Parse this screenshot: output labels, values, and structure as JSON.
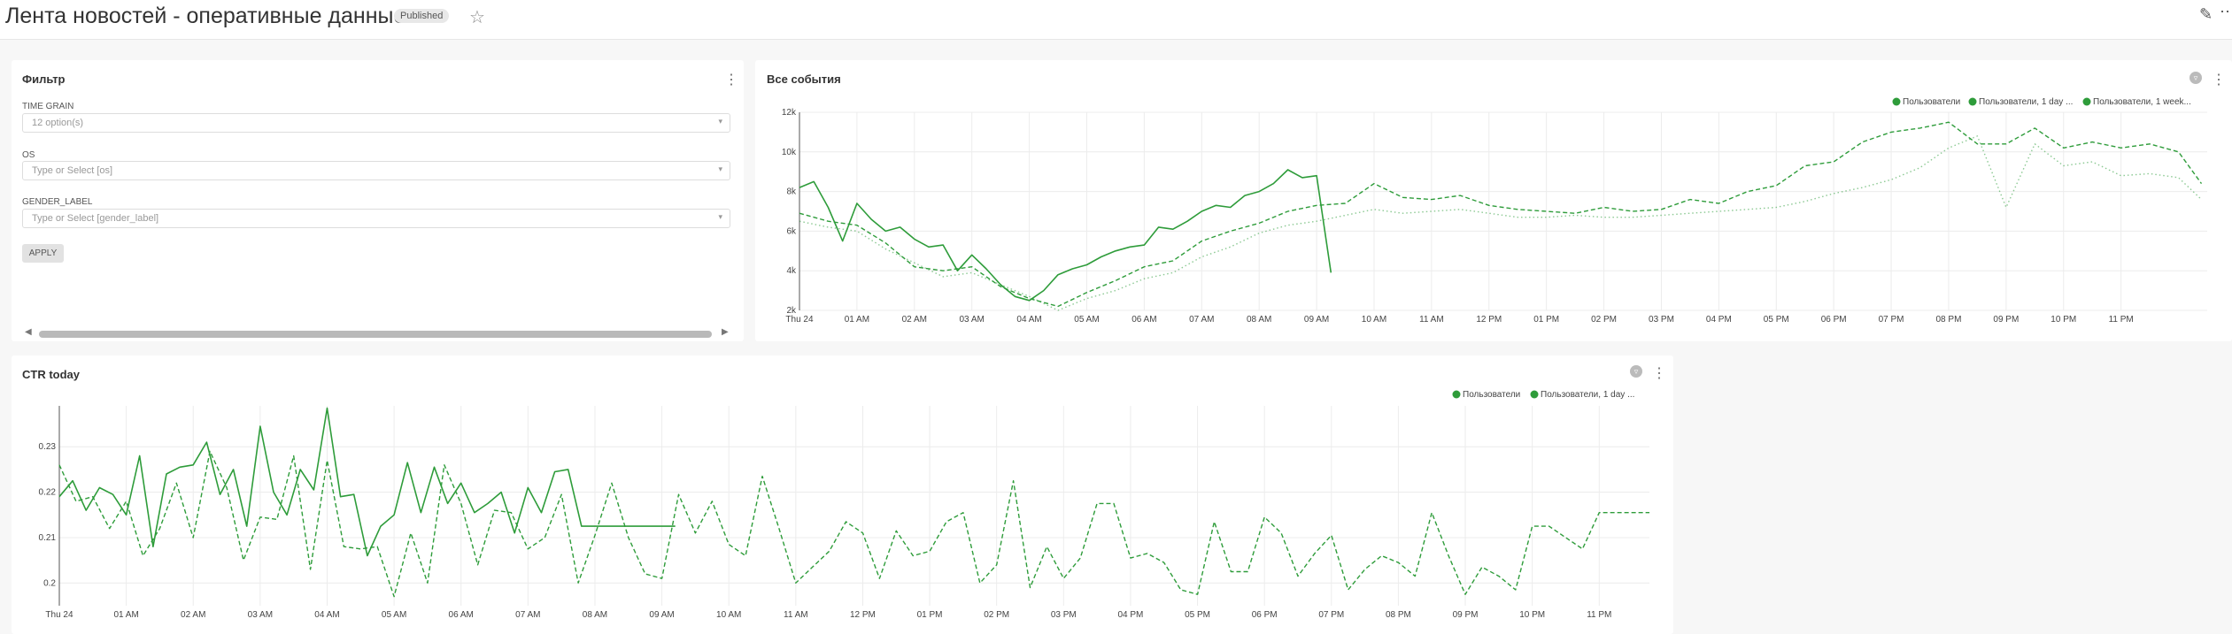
{
  "header": {
    "title": "Лента новостей - оперативные данные",
    "badge": "Published",
    "star_icon": "star-icon",
    "edit_icon": "edit-icon",
    "more_icon": "more-icon"
  },
  "filter_panel": {
    "title": "Фильтр",
    "fields": [
      {
        "label": "TIME GRAIN",
        "value": "12 option(s)"
      },
      {
        "label": "OS",
        "placeholder": "Type or Select [os]"
      },
      {
        "label": "GENDER_LABEL",
        "placeholder": "Type or Select [gender_label]"
      }
    ],
    "apply_label": "APPLY"
  },
  "colors": {
    "series": "#2e9c3a",
    "grid": "#ececec"
  },
  "chart_data": [
    {
      "type": "line",
      "title": "Все события",
      "legend_position": "top-right",
      "legend": [
        "Пользователи",
        "Пользователи, 1 day ...",
        "Пользователи, 1 week..."
      ],
      "x_tick_labels": [
        "Thu 24",
        "01 AM",
        "02 AM",
        "03 AM",
        "04 AM",
        "05 AM",
        "06 AM",
        "07 AM",
        "08 AM",
        "09 AM",
        "10 AM",
        "11 AM",
        "12 PM",
        "01 PM",
        "02 PM",
        "03 PM",
        "04 PM",
        "05 PM",
        "06 PM",
        "07 PM",
        "08 PM",
        "09 PM",
        "10 PM",
        "11 PM"
      ],
      "x_unit_hours": true,
      "xlim": [
        0,
        24.5
      ],
      "y_tick_labels": [
        "2k",
        "4k",
        "6k",
        "8k",
        "10k",
        "12k"
      ],
      "ylim": [
        2000,
        12000
      ],
      "grid": true,
      "series": [
        {
          "style": "solid",
          "x": [
            0,
            0.25,
            0.5,
            0.75,
            1,
            1.25,
            1.5,
            1.75,
            2,
            2.25,
            2.5,
            2.75,
            3,
            3.25,
            3.5,
            3.75,
            4,
            4.25,
            4.5,
            4.75,
            5,
            5.25,
            5.5,
            5.75,
            6,
            6.25,
            6.5,
            6.75,
            7,
            7.25,
            7.5,
            7.75,
            8,
            8.25,
            8.5,
            8.75,
            9,
            9.25
          ],
          "y": [
            8200,
            8500,
            7200,
            5500,
            7400,
            6600,
            6000,
            6200,
            5600,
            5200,
            5300,
            4000,
            4800,
            4100,
            3300,
            2700,
            2500,
            3000,
            3800,
            4100,
            4300,
            4700,
            5000,
            5200,
            5300,
            6200,
            6100,
            6500,
            7000,
            7300,
            7200,
            7800,
            8000,
            8400,
            9100,
            8700,
            8800,
            3900
          ]
        },
        {
          "style": "dashed",
          "x": [
            0,
            0.5,
            1,
            1.5,
            2,
            2.5,
            3,
            3.5,
            4,
            4.5,
            5,
            5.5,
            6,
            6.5,
            7,
            7.5,
            8,
            8.5,
            9,
            9.5,
            10,
            10.5,
            11,
            11.5,
            12,
            12.5,
            13,
            13.5,
            14,
            14.5,
            15,
            15.5,
            16,
            16.5,
            17,
            17.5,
            18,
            18.5,
            19,
            19.5,
            20,
            20.5,
            21,
            21.5,
            22,
            22.5,
            23,
            23.5,
            24,
            24.4
          ],
          "y": [
            6900,
            6500,
            6300,
            5400,
            4200,
            4000,
            4200,
            3200,
            2600,
            2200,
            2900,
            3500,
            4200,
            4500,
            5500,
            6000,
            6400,
            7000,
            7300,
            7400,
            8400,
            7700,
            7600,
            7800,
            7300,
            7100,
            7000,
            6900,
            7200,
            7000,
            7100,
            7600,
            7400,
            8000,
            8300,
            9300,
            9500,
            10500,
            11000,
            11200,
            11500,
            10400,
            10400,
            11200,
            10200,
            10500,
            10200,
            10400,
            10000,
            8400
          ]
        },
        {
          "style": "dotted",
          "x": [
            0,
            0.5,
            1,
            1.5,
            2,
            2.5,
            3,
            3.5,
            4,
            4.5,
            5,
            5.5,
            6,
            6.5,
            7,
            7.5,
            8,
            8.5,
            9,
            9.5,
            10,
            10.5,
            11,
            11.5,
            12,
            12.5,
            13,
            13.5,
            14,
            14.5,
            15,
            15.5,
            16,
            16.5,
            17,
            17.5,
            18,
            18.5,
            19,
            19.5,
            20,
            20.5,
            21,
            21.5,
            22,
            22.5,
            23,
            23.5,
            24,
            24.4
          ],
          "y": [
            6500,
            6200,
            6000,
            5100,
            4400,
            3700,
            3900,
            3300,
            2700,
            2000,
            2600,
            3000,
            3600,
            3900,
            4700,
            5200,
            5900,
            6300,
            6500,
            6800,
            7100,
            6900,
            7000,
            7100,
            6900,
            6700,
            6700,
            6800,
            6700,
            6700,
            6800,
            6900,
            7000,
            7100,
            7200,
            7500,
            7900,
            8200,
            8600,
            9200,
            10200,
            10800,
            7200,
            10400,
            9300,
            9500,
            8800,
            8900,
            8700,
            7600
          ]
        }
      ]
    },
    {
      "type": "line",
      "title": "CTR today",
      "legend_position": "top-right",
      "legend": [
        "Пользователи",
        "Пользователи, 1 day ..."
      ],
      "x_tick_labels": [
        "Thu 24",
        "01 AM",
        "02 AM",
        "03 AM",
        "04 AM",
        "05 AM",
        "06 AM",
        "07 AM",
        "08 AM",
        "09 AM",
        "10 AM",
        "11 AM",
        "12 PM",
        "01 PM",
        "02 PM",
        "03 PM",
        "04 PM",
        "05 PM",
        "06 PM",
        "07 PM",
        "08 PM",
        "09 PM",
        "10 PM",
        "11 PM"
      ],
      "xlim": [
        0,
        23.75
      ],
      "y_tick_labels": [
        "0.2",
        "0.21",
        "0.22",
        "0.23"
      ],
      "y_tick_values": [
        0.2,
        0.21,
        0.22,
        0.23
      ],
      "ylim": [
        0.195,
        0.239
      ],
      "grid": true,
      "series": [
        {
          "style": "solid",
          "x": [
            0,
            0.2,
            0.4,
            0.6,
            0.8,
            1,
            1.2,
            1.4,
            1.6,
            1.8,
            2,
            2.2,
            2.4,
            2.6,
            2.8,
            3,
            3.2,
            3.4,
            3.6,
            3.8,
            4,
            4.2,
            4.4,
            4.6,
            4.8,
            5,
            5.2,
            5.4,
            5.6,
            5.8,
            6,
            6.2,
            6.4,
            6.6,
            6.8,
            7,
            7.2,
            7.4,
            7.6,
            7.8,
            8,
            8.2,
            8.4,
            8.6,
            8.8,
            9,
            9.2
          ],
          "y": [
            0.219,
            0.2225,
            0.216,
            0.221,
            0.2195,
            0.215,
            0.228,
            0.208,
            0.224,
            0.2255,
            0.226,
            0.231,
            0.2195,
            0.225,
            0.2125,
            0.2345,
            0.22,
            0.215,
            0.225,
            0.2205,
            0.2385,
            0.219,
            0.2195,
            0.206,
            0.2125,
            0.215,
            0.2265,
            0.2155,
            0.2255,
            0.2175,
            0.222,
            0.2155,
            0.2175,
            0.22,
            0.211,
            0.221,
            0.2155,
            0.2245,
            0.225,
            0.2125,
            0.2125,
            0.2125,
            0.2125,
            0.2125,
            0.2125,
            0.2125,
            0.2125
          ]
        },
        {
          "style": "dashed",
          "x": [
            0,
            0.25,
            0.5,
            0.75,
            1,
            1.25,
            1.5,
            1.75,
            2,
            2.25,
            2.5,
            2.75,
            3,
            3.25,
            3.5,
            3.75,
            4,
            4.25,
            4.5,
            4.75,
            5,
            5.25,
            5.5,
            5.75,
            6,
            6.25,
            6.5,
            6.75,
            7,
            7.25,
            7.5,
            7.75,
            8,
            8.25,
            8.5,
            8.75,
            9,
            9.25,
            9.5,
            9.75,
            10,
            10.25,
            10.5,
            10.75,
            11,
            11.25,
            11.5,
            11.75,
            12,
            12.25,
            12.5,
            12.75,
            13,
            13.25,
            13.5,
            13.75,
            14,
            14.25,
            14.5,
            14.75,
            15,
            15.25,
            15.5,
            15.75,
            16,
            16.25,
            16.5,
            16.75,
            17,
            17.25,
            17.5,
            17.75,
            18,
            18.25,
            18.5,
            18.75,
            19,
            19.25,
            19.5,
            19.75,
            20,
            20.25,
            20.5,
            20.75,
            21,
            21.25,
            21.5,
            21.75,
            22,
            22.25,
            22.5,
            22.75,
            23,
            23.25,
            23.5,
            23.75
          ],
          "y": [
            0.226,
            0.218,
            0.219,
            0.212,
            0.218,
            0.206,
            0.212,
            0.222,
            0.21,
            0.229,
            0.221,
            0.205,
            0.2145,
            0.214,
            0.228,
            0.203,
            0.227,
            0.208,
            0.2075,
            0.208,
            0.197,
            0.211,
            0.2,
            0.226,
            0.2175,
            0.204,
            0.216,
            0.2155,
            0.2075,
            0.21,
            0.2195,
            0.2,
            0.2105,
            0.222,
            0.21,
            0.202,
            0.201,
            0.2195,
            0.211,
            0.218,
            0.2085,
            0.206,
            0.2235,
            0.212,
            0.2,
            0.2035,
            0.207,
            0.2135,
            0.211,
            0.201,
            0.2115,
            0.206,
            0.207,
            0.2135,
            0.2155,
            0.2,
            0.204,
            0.2225,
            0.199,
            0.208,
            0.201,
            0.2055,
            0.2175,
            0.2175,
            0.2055,
            0.2065,
            0.2045,
            0.1985,
            0.1975,
            0.2135,
            0.2025,
            0.2025,
            0.2145,
            0.211,
            0.2015,
            0.2065,
            0.2105,
            0.1985,
            0.203,
            0.206,
            0.2045,
            0.2015,
            0.2155,
            0.206,
            0.1975,
            0.2035,
            0.2015,
            0.1985,
            0.2125,
            0.2125,
            0.21,
            0.2075,
            0.2155,
            0.2155,
            0.2155,
            0.2155
          ]
        }
      ]
    }
  ]
}
